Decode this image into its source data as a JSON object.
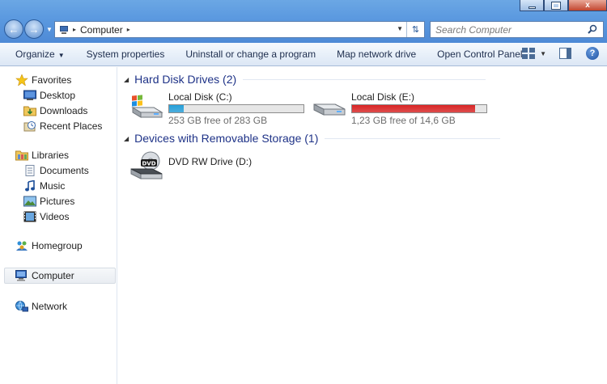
{
  "window": {
    "minimize_glyph": "",
    "maximize_glyph": "",
    "close_glyph": "x"
  },
  "address": {
    "crumb": "Computer",
    "sep1": "▸",
    "sep2": "▸"
  },
  "search": {
    "placeholder": "Search Computer"
  },
  "toolbar": {
    "organize": "Organize",
    "system_properties": "System properties",
    "uninstall": "Uninstall or change a program",
    "map_drive": "Map network drive",
    "control_panel": "Open Control Panel",
    "help": "?"
  },
  "nav": {
    "favorites": "Favorites",
    "desktop": "Desktop",
    "downloads": "Downloads",
    "recent": "Recent Places",
    "libraries": "Libraries",
    "documents": "Documents",
    "music": "Music",
    "pictures": "Pictures",
    "videos": "Videos",
    "homegroup": "Homegroup",
    "computer": "Computer",
    "network": "Network"
  },
  "groups": {
    "hdd": "Hard Disk Drives (2)",
    "removable": "Devices with Removable Storage (1)"
  },
  "drives": {
    "c": {
      "name": "Local Disk (C:)",
      "free": "253 GB free of 283 GB",
      "used_fraction": 0.106,
      "bar_color": "#26a0da"
    },
    "e": {
      "name": "Local Disk (E:)",
      "free": "1,23 GB free of 14,6 GB",
      "used_fraction": 0.916,
      "bar_color": "#da2626"
    },
    "d": {
      "name": "DVD RW Drive (D:)",
      "label": "DVD"
    }
  },
  "colors": {
    "group_title": "#1e3287",
    "accent_blue": "#26a0da",
    "warning_red": "#da2626"
  }
}
